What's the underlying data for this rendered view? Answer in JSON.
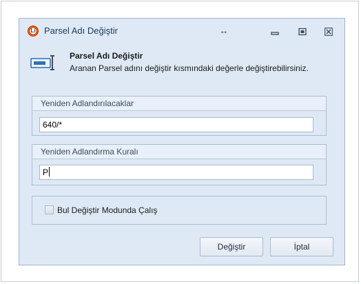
{
  "window": {
    "title": "Parsel Adı Değiştir",
    "resize_glyph": "↔",
    "minimize_glyph": "▭",
    "maximize_glyph": "▣",
    "close_glyph": "☒"
  },
  "header": {
    "title": "Parsel Adı Değiştir",
    "description": "Aranan Parsel adını değiştir kısmındaki değerle değiştirebilirsiniz.",
    "icon": "rename-icon"
  },
  "rename_targets": {
    "label": "Yeniden Adlandırılacaklar",
    "value": "640/*"
  },
  "rename_rule": {
    "label": "Yeniden Adlandırma Kuralı",
    "value": "P"
  },
  "find_replace": {
    "label": "Bul Değiştir Modunda Çalış",
    "checked": false
  },
  "buttons": {
    "apply_label": "Değiştir",
    "cancel_label": "İptal"
  },
  "colors": {
    "window_bg": "#dfe9f5",
    "group_header_bg": "#e9f0f9",
    "border": "#a9bdd6",
    "app_icon_accent": "#e8590c"
  }
}
